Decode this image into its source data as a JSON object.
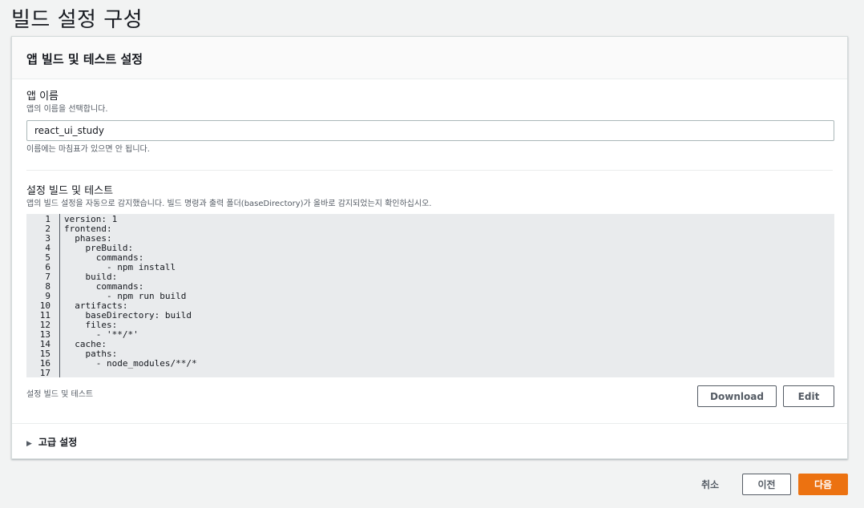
{
  "page": {
    "title": "빌드 설정 구성"
  },
  "panel": {
    "header": "앱 빌드 및 테스트 설정",
    "app_name": {
      "label": "앱 이름",
      "description": "앱의 이름을 선택합니다.",
      "value": "react_ui_study",
      "hint": "이름에는 마침표가 있으면 안 됩니다."
    },
    "build_settings": {
      "label": "설정 빌드 및 테스트",
      "description": "앱의 빌드 설정을 자동으로 감지했습니다. 빌드 명령과 출력 폴더(baseDirectory)가 올바로 감지되었는지 확인하십시오.",
      "line_numbers": [
        "1",
        "2",
        "3",
        "4",
        "5",
        "6",
        "7",
        "8",
        "9",
        "10",
        "11",
        "12",
        "13",
        "14",
        "15",
        "16",
        "17"
      ],
      "code_lines": [
        "version: 1",
        "frontend:",
        "  phases:",
        "    preBuild:",
        "      commands:",
        "        - npm install",
        "    build:",
        "      commands:",
        "        - npm run build",
        "  artifacts:",
        "    baseDirectory: build",
        "    files:",
        "      - '**/*'",
        "  cache:",
        "    paths:",
        "      - node_modules/**/*",
        ""
      ],
      "caption": "설정 빌드 및 테스트",
      "download_label": "Download",
      "edit_label": "Edit"
    },
    "advanced": {
      "label": "고급 설정",
      "icon": "caret-right-icon"
    }
  },
  "footer": {
    "cancel_label": "취소",
    "previous_label": "이전",
    "next_label": "다음"
  },
  "colors": {
    "primary_button": "#ec7211",
    "code_background": "#e9ebed",
    "page_background": "#f2f3f3"
  }
}
